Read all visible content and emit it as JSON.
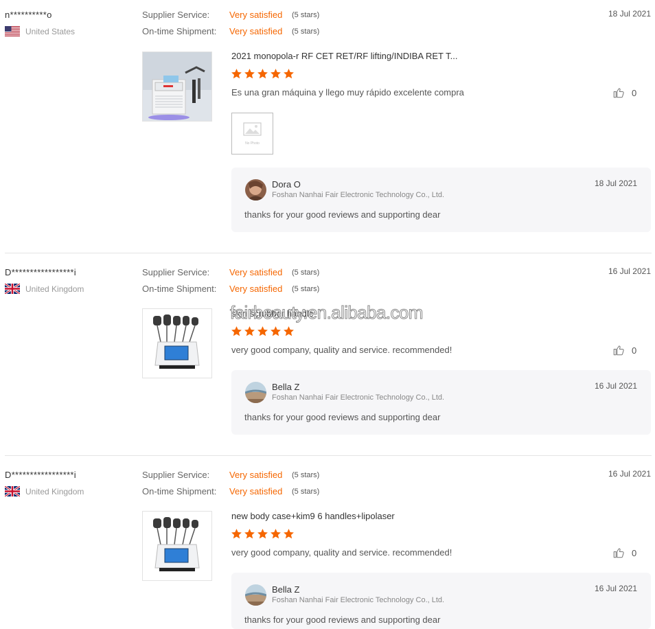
{
  "reviews": [
    {
      "buyer": "n**********o",
      "country": "United States",
      "supplier_service_label": "Supplier Service:",
      "supplier_service_value": "Very satisfied",
      "supplier_service_stars": "(5 stars)",
      "shipment_label": "On-time Shipment:",
      "shipment_value": "Very satisfied",
      "shipment_stars": "(5 stars)",
      "date": "18 Jul 2021",
      "product_title": "2021 monopola-r RF CET RET/RF lifting/INDIBA RET T...",
      "rating": 5,
      "text": "Es una gran máquina y llego muy rápido excelente compra",
      "likes": "0",
      "photo_placeholder": "No Photo",
      "reply": {
        "name": "Dora O",
        "company": "Foshan Nanhai Fair Electronic Technology Co., Ltd.",
        "date": "18 Jul 2021",
        "text": "thanks for your good reviews and supporting dear"
      }
    },
    {
      "buyer": "D*****************i",
      "country": "United Kingdom",
      "supplier_service_label": "Supplier Service:",
      "supplier_service_value": "Very satisfied",
      "supplier_service_stars": "(5 stars)",
      "shipment_label": "On-time Shipment:",
      "shipment_value": "Very satisfied",
      "shipment_stars": "(5 stars)",
      "date": "16 Jul 2021",
      "product_title": "skin scrubber handle",
      "rating": 5,
      "text": "very good company, quality and service. recommended!",
      "likes": "0",
      "reply": {
        "name": "Bella Z",
        "company": "Foshan Nanhai Fair Electronic Technology Co., Ltd.",
        "date": "16 Jul 2021",
        "text": "thanks for your good reviews and supporting dear"
      }
    },
    {
      "buyer": "D*****************i",
      "country": "United Kingdom",
      "supplier_service_label": "Supplier Service:",
      "supplier_service_value": "Very satisfied",
      "supplier_service_stars": "(5 stars)",
      "shipment_label": "On-time Shipment:",
      "shipment_value": "Very satisfied",
      "shipment_stars": "(5 stars)",
      "date": "16 Jul 2021",
      "product_title": "new body case+kim9 6 handles+lipolaser",
      "rating": 5,
      "text": "very good company, quality and service. recommended!",
      "likes": "0",
      "reply": {
        "name": "Bella Z",
        "company": "Foshan Nanhai Fair Electronic Technology Co., Ltd.",
        "date": "16 Jul 2021",
        "text": "thanks for your good reviews and supporting dear"
      }
    }
  ],
  "watermark": "fairbeauty.en.alibaba.com",
  "colors": {
    "rating_accent": "#f56600",
    "star": "#f56600",
    "reply_background": "#f6f6f8"
  },
  "icons": [
    "us-flag-icon",
    "uk-flag-icon",
    "star-icon",
    "thumbs-up-icon",
    "no-photo-icon"
  ]
}
